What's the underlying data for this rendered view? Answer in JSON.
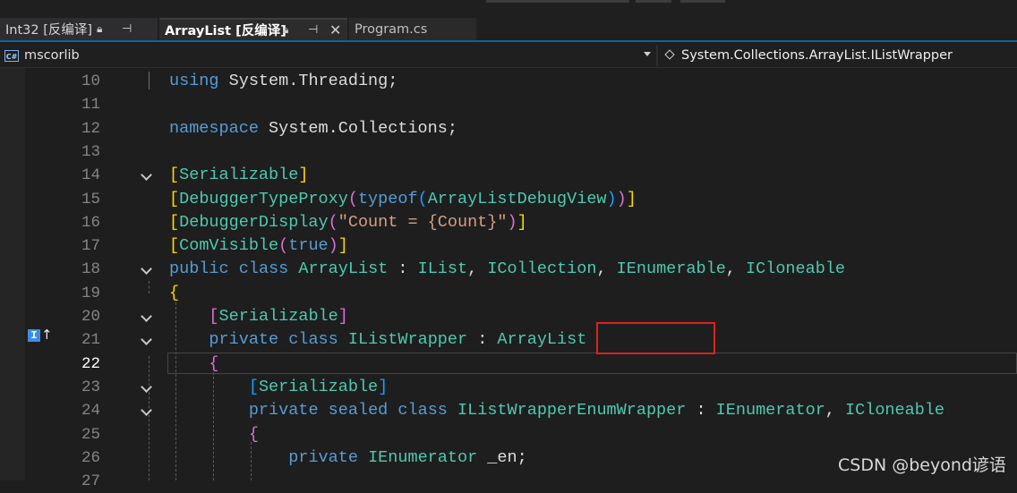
{
  "tabs": [
    {
      "label": "Int32 [反编译]",
      "active": false,
      "icons": [
        "lock-icon",
        "pin-icon"
      ]
    },
    {
      "label": "ArrayList [反编译]",
      "active": true,
      "icons": [
        "lock-icon",
        "pin-icon",
        "close-icon"
      ]
    },
    {
      "label": "Program.cs",
      "active": false,
      "icons": []
    }
  ],
  "navbar": {
    "project": "mscorlib",
    "project_icon_text": "C#",
    "member": "System.Collections.ArrayList.IListWrapper"
  },
  "editor": {
    "current_line": 22,
    "lines": [
      {
        "num": "10",
        "tokens": [
          [
            "kw",
            "using"
          ],
          [
            "pl",
            " System."
          ],
          [
            "pl",
            "Threading;"
          ]
        ]
      },
      {
        "num": "11",
        "tokens": []
      },
      {
        "num": "12",
        "tokens": [
          [
            "kw",
            "namespace"
          ],
          [
            "pl",
            " System.Collections;"
          ]
        ]
      },
      {
        "num": "13",
        "tokens": []
      },
      {
        "num": "14",
        "tokens": [
          [
            "br1",
            "["
          ],
          [
            "attr",
            "Serializable"
          ],
          [
            "br1",
            "]"
          ]
        ]
      },
      {
        "num": "15",
        "tokens": [
          [
            "br1",
            "["
          ],
          [
            "attr",
            "DebuggerTypeProxy"
          ],
          [
            "br2",
            "("
          ],
          [
            "kw",
            "typeof"
          ],
          [
            "br3",
            "("
          ],
          [
            "ty",
            "ArrayListDebugView"
          ],
          [
            "br3",
            ")"
          ],
          [
            "br2",
            ")"
          ],
          [
            "br1",
            "]"
          ]
        ]
      },
      {
        "num": "16",
        "tokens": [
          [
            "br1",
            "["
          ],
          [
            "attr",
            "DebuggerDisplay"
          ],
          [
            "br2",
            "("
          ],
          [
            "str",
            "\"Count = {Count}\""
          ],
          [
            "br2",
            ")"
          ],
          [
            "br1",
            "]"
          ]
        ]
      },
      {
        "num": "17",
        "tokens": [
          [
            "br1",
            "["
          ],
          [
            "attr",
            "ComVisible"
          ],
          [
            "br2",
            "("
          ],
          [
            "kw",
            "true"
          ],
          [
            "br2",
            ")"
          ],
          [
            "br1",
            "]"
          ]
        ]
      },
      {
        "num": "18",
        "tokens": [
          [
            "kw",
            "public"
          ],
          [
            "pl",
            " "
          ],
          [
            "kw",
            "class"
          ],
          [
            "pl",
            " "
          ],
          [
            "ty",
            "ArrayList"
          ],
          [
            "pl",
            " : "
          ],
          [
            "ty",
            "IList"
          ],
          [
            "pl",
            ", "
          ],
          [
            "ty",
            "ICollection"
          ],
          [
            "pl",
            ", "
          ],
          [
            "ty",
            "IEnumerable"
          ],
          [
            "pl",
            ", "
          ],
          [
            "ty",
            "ICloneable"
          ]
        ]
      },
      {
        "num": "19",
        "tokens": [
          [
            "br1",
            "{"
          ]
        ]
      },
      {
        "num": "20",
        "tokens": [
          [
            "pl",
            "    "
          ],
          [
            "br2",
            "["
          ],
          [
            "attr",
            "Serializable"
          ],
          [
            "br2",
            "]"
          ]
        ]
      },
      {
        "num": "21",
        "tokens": [
          [
            "pl",
            "    "
          ],
          [
            "kw",
            "private"
          ],
          [
            "pl",
            " "
          ],
          [
            "kw",
            "class"
          ],
          [
            "pl",
            " "
          ],
          [
            "ty",
            "IListWrapper"
          ],
          [
            "pl",
            " : "
          ],
          [
            "ty",
            "ArrayList"
          ]
        ]
      },
      {
        "num": "22",
        "tokens": [
          [
            "pl",
            "    "
          ],
          [
            "br2",
            "{"
          ]
        ]
      },
      {
        "num": "23",
        "tokens": [
          [
            "pl",
            "        "
          ],
          [
            "br3",
            "["
          ],
          [
            "attr",
            "Serializable"
          ],
          [
            "br3",
            "]"
          ]
        ]
      },
      {
        "num": "24",
        "tokens": [
          [
            "pl",
            "        "
          ],
          [
            "kw",
            "private"
          ],
          [
            "pl",
            " "
          ],
          [
            "kw",
            "sealed"
          ],
          [
            "pl",
            " "
          ],
          [
            "kw",
            "class"
          ],
          [
            "pl",
            " "
          ],
          [
            "ty",
            "IListWrapperEnumWrapper"
          ],
          [
            "pl",
            " : "
          ],
          [
            "ty",
            "IEnumerator"
          ],
          [
            "pl",
            ", "
          ],
          [
            "ty",
            "ICloneable"
          ]
        ]
      },
      {
        "num": "25",
        "tokens": [
          [
            "pl",
            "        "
          ],
          [
            "br2",
            "{"
          ]
        ]
      },
      {
        "num": "26",
        "tokens": [
          [
            "pl",
            "            "
          ],
          [
            "kw",
            "private"
          ],
          [
            "pl",
            " "
          ],
          [
            "ty",
            "IEnumerator"
          ],
          [
            "pl",
            " _en;"
          ]
        ]
      },
      {
        "num": "27",
        "tokens": []
      }
    ]
  },
  "impl_marker": {
    "icon_text": "I",
    "arrow": "↑"
  },
  "watermark": "CSDN @beyond谚语"
}
